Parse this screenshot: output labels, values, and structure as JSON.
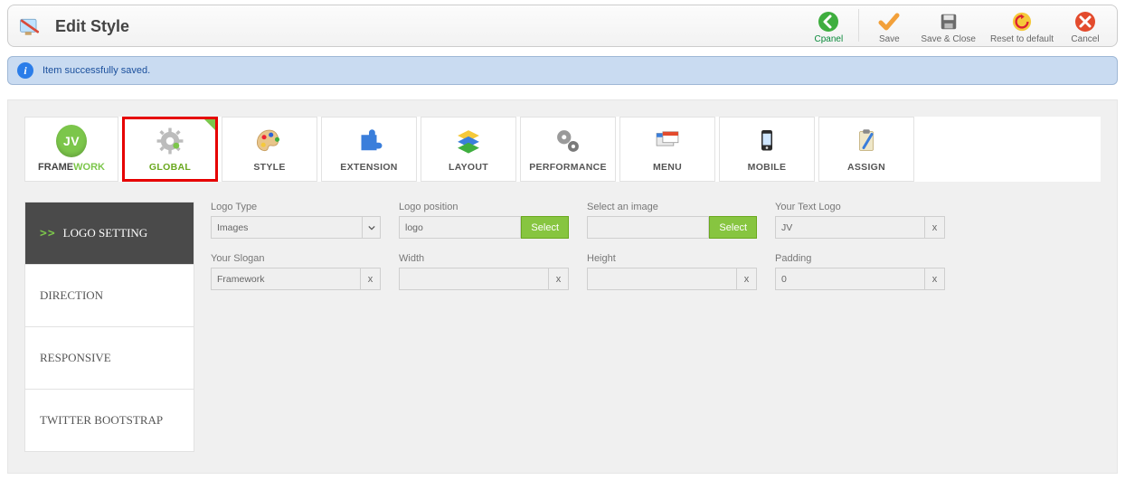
{
  "header": {
    "title": "Edit Style",
    "buttons": {
      "cpanel": "Cpanel",
      "save": "Save",
      "save_close": "Save & Close",
      "reset": "Reset to default",
      "cancel": "Cancel"
    }
  },
  "infobar": {
    "message": "Item successfully saved."
  },
  "tabs": {
    "framework_prefix": "FRAME",
    "framework_suffix": "WORK",
    "jv_badge": "JV",
    "global": "GLOBAL",
    "style": "STYLE",
    "extension": "EXTENSION",
    "layout": "LAYOUT",
    "performance": "PERFORMANCE",
    "menu": "MENU",
    "mobile": "MOBILE",
    "assign": "ASSIGN"
  },
  "sidebar": {
    "items": [
      {
        "label": "LOGO SETTING",
        "active": true
      },
      {
        "label": "DIRECTION",
        "active": false
      },
      {
        "label": "RESPONSIVE",
        "active": false
      },
      {
        "label": "TWITTER BOOTSTRAP",
        "active": false
      }
    ]
  },
  "form": {
    "row1": {
      "logo_type": {
        "label": "Logo Type",
        "value": "Images",
        "type": "dropdown"
      },
      "logo_position": {
        "label": "Logo position",
        "value": "logo",
        "type": "select-btn",
        "btn": "Select"
      },
      "select_image": {
        "label": "Select an image",
        "value": "",
        "type": "select-btn",
        "btn": "Select"
      },
      "text_logo": {
        "label": "Your Text Logo",
        "value": "JV",
        "type": "clearable"
      }
    },
    "row2": {
      "slogan": {
        "label": "Your Slogan",
        "value": "Framework",
        "type": "clearable"
      },
      "width": {
        "label": "Width",
        "value": "",
        "type": "clearable"
      },
      "height": {
        "label": "Height",
        "value": "",
        "type": "clearable"
      },
      "padding": {
        "label": "Padding",
        "value": "0",
        "type": "clearable"
      }
    }
  }
}
